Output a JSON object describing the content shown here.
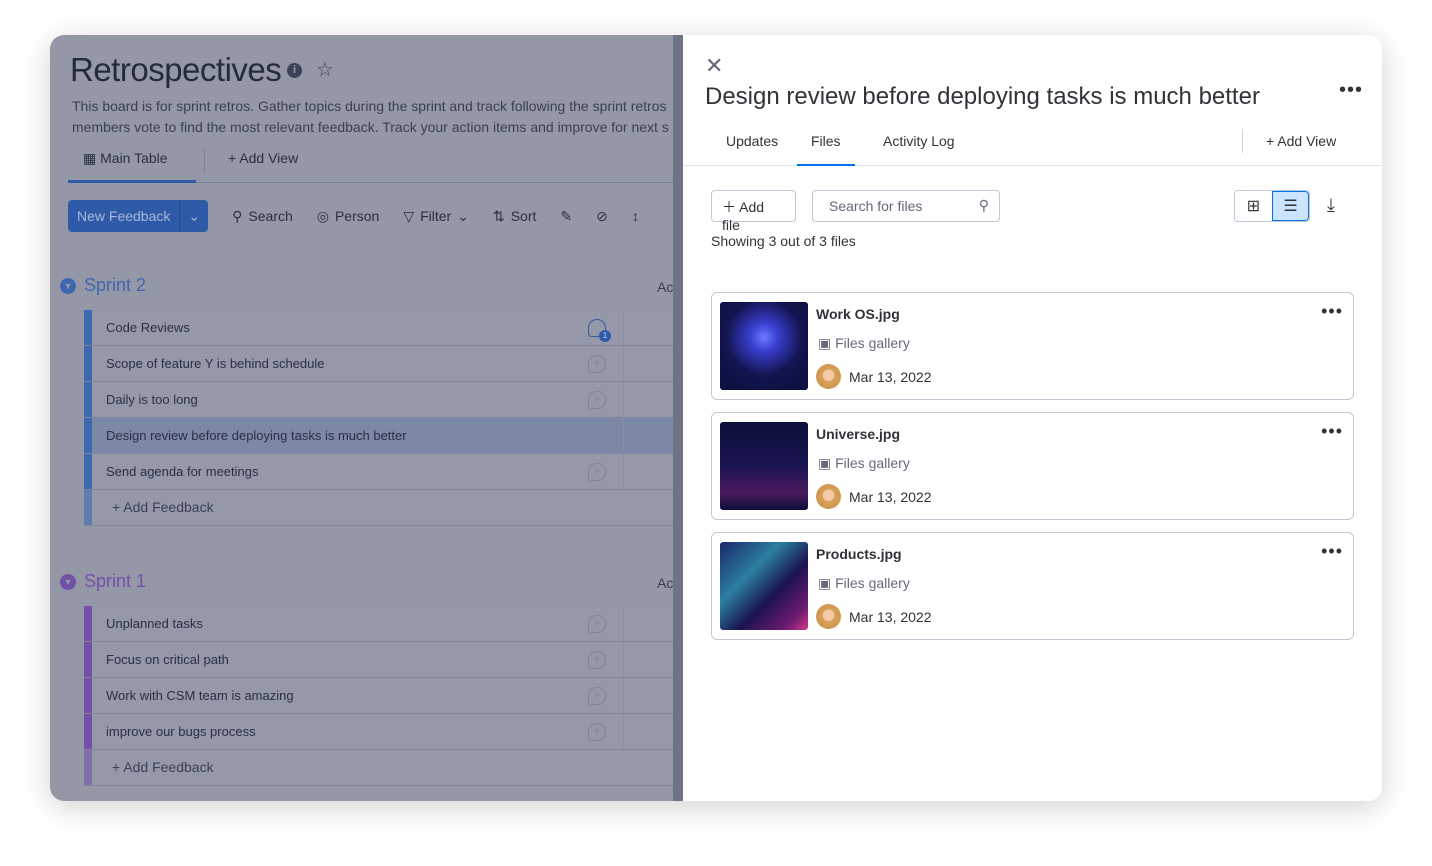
{
  "board": {
    "title": "Retrospectives",
    "description_line1": "This board is for sprint retros. Gather topics during the sprint and track following the sprint retros",
    "description_line2": "members vote to find the most relevant feedback. Track your action items and improve for next s",
    "views": {
      "main": "Main Table",
      "add": "+  Add View"
    },
    "toolbar": {
      "new": "New Feedback",
      "search": "Search",
      "person": "Person",
      "filter": "Filter",
      "sort": "Sort"
    },
    "groups": [
      {
        "name": "Sprint 2",
        "color": "#3f67b0",
        "col": "Ac",
        "items": [
          "Code Reviews",
          "Scope of feature Y is behind schedule",
          "Daily is too long",
          "Design review before deploying tasks is much better",
          "Send agenda for meetings"
        ],
        "add": "+ Add Feedback",
        "comment_badge": "1"
      },
      {
        "name": "Sprint 1",
        "color": "#7351a8",
        "col": "Ac",
        "items": [
          "Unplanned tasks",
          "Focus on critical path",
          "Work with CSM team is amazing",
          "improve our bugs process"
        ],
        "add": "+ Add Feedback"
      }
    ]
  },
  "panel": {
    "title": "Design review before deploying tasks is much better",
    "tabs": [
      "Updates",
      "Files",
      "Activity Log"
    ],
    "active_tab": "Files",
    "add_view": "+  Add View",
    "add_file": "Add file",
    "search_placeholder": "Search for files",
    "count": "Showing 3 out of 3 files",
    "accent": "#0073ea",
    "files": [
      {
        "name": "Work OS.jpg",
        "source": "Files gallery",
        "date": "Mar 13, 2022"
      },
      {
        "name": "Universe.jpg",
        "source": "Files gallery",
        "date": "Mar 13, 2022"
      },
      {
        "name": "Products.jpg",
        "source": "Files gallery",
        "date": "Mar 13, 2022"
      }
    ]
  }
}
